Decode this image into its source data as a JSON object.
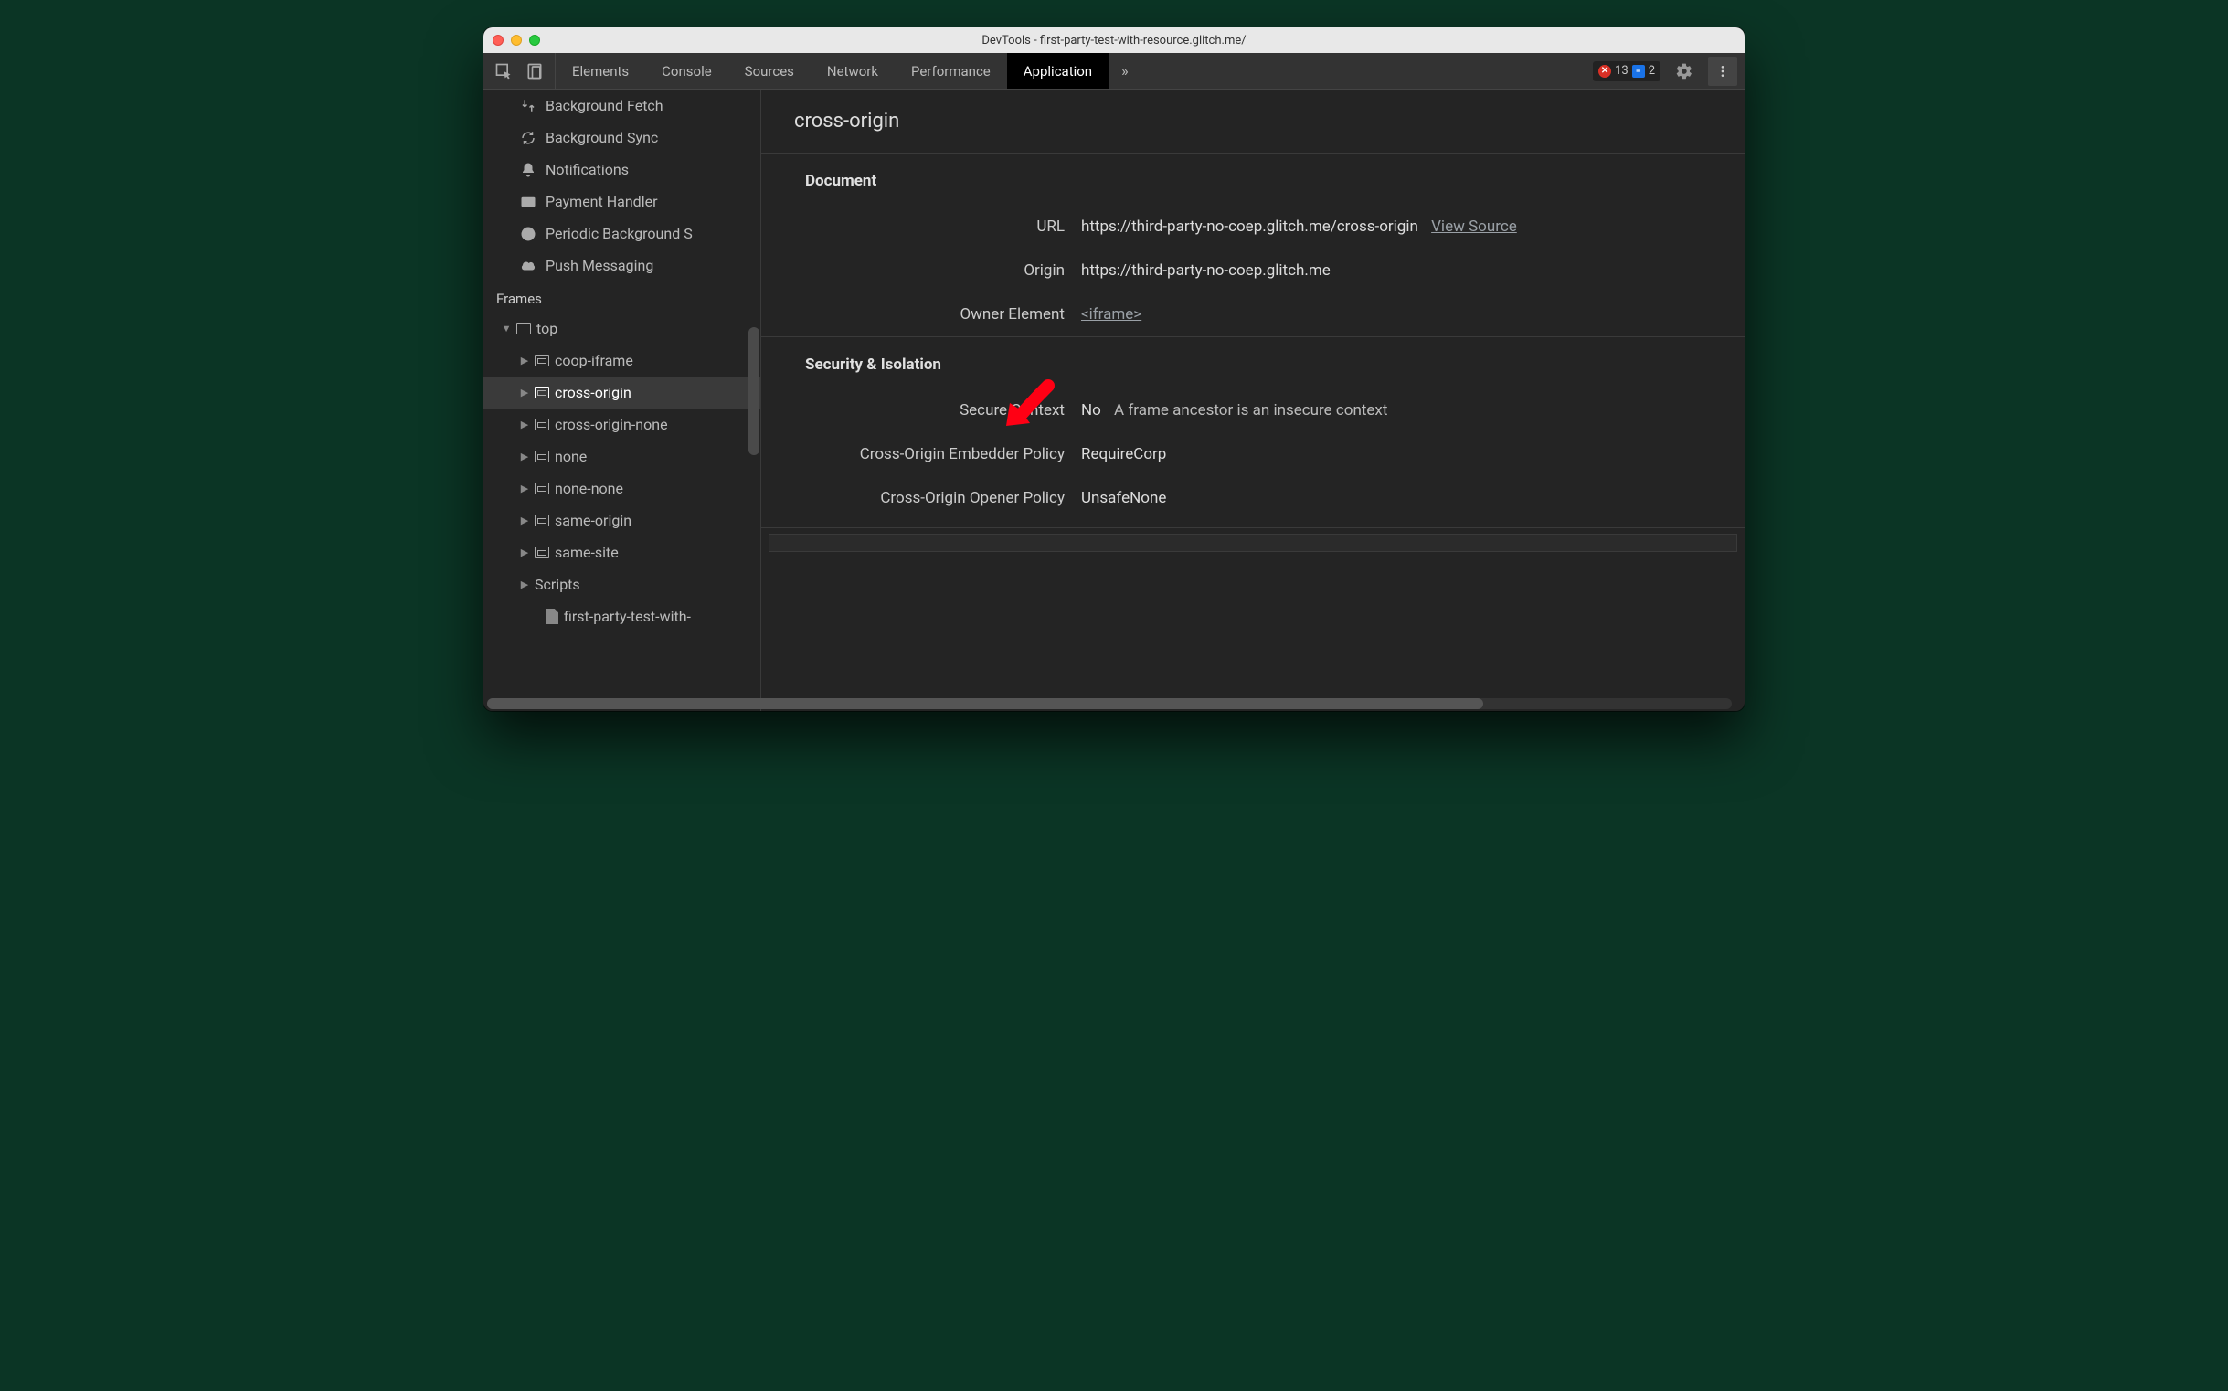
{
  "window": {
    "title": "DevTools - first-party-test-with-resource.glitch.me/"
  },
  "toolbar": {
    "tabs": [
      "Elements",
      "Console",
      "Sources",
      "Network",
      "Performance",
      "Application"
    ],
    "active_tab_index": 5,
    "more_tabs_glyph": "»",
    "error_count": "13",
    "message_count": "2"
  },
  "sidebar": {
    "bg_items": [
      {
        "icon": "background-fetch",
        "label": "Background Fetch"
      },
      {
        "icon": "background-sync",
        "label": "Background Sync"
      },
      {
        "icon": "notifications",
        "label": "Notifications"
      },
      {
        "icon": "payment-handler",
        "label": "Payment Handler"
      },
      {
        "icon": "periodic-background-sync",
        "label": "Periodic Background S"
      },
      {
        "icon": "push-messaging",
        "label": "Push Messaging"
      }
    ],
    "frames_header": "Frames",
    "top_label": "top",
    "frames": [
      "coop-iframe",
      "cross-origin",
      "cross-origin-none",
      "none",
      "none-none",
      "same-origin",
      "same-site"
    ],
    "selected_frame_index": 1,
    "scripts_label": "Scripts",
    "file_label": "first-party-test-with-"
  },
  "main": {
    "title": "cross-origin",
    "document_section": "Document",
    "doc": {
      "url_label": "URL",
      "url_value": "https://third-party-no-coep.glitch.me/cross-origin",
      "view_source": "View Source",
      "origin_label": "Origin",
      "origin_value": "https://third-party-no-coep.glitch.me",
      "owner_label": "Owner Element",
      "owner_value": "<iframe>"
    },
    "security_section": "Security & Isolation",
    "sec": {
      "ctx_label": "Secure Context",
      "ctx_value": "No",
      "ctx_note": "A frame ancestor is an insecure context",
      "coep_label": "Cross-Origin Embedder Policy",
      "coep_value": "RequireCorp",
      "coop_label": "Cross-Origin Opener Policy",
      "coop_value": "UnsafeNone"
    }
  },
  "annotation": {
    "arrow_color": "#ff0014"
  }
}
